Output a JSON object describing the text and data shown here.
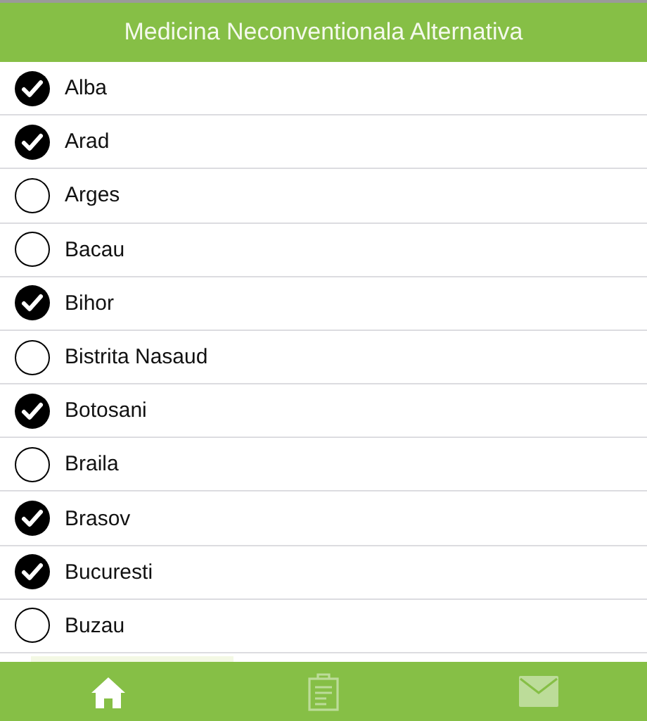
{
  "header": {
    "title": "Medicina Neconventionala Alternativa"
  },
  "items": [
    {
      "label": "Alba",
      "checked": true
    },
    {
      "label": "Arad",
      "checked": true
    },
    {
      "label": "Arges",
      "checked": false
    },
    {
      "label": "Bacau",
      "checked": false
    },
    {
      "label": "Bihor",
      "checked": true
    },
    {
      "label": "Bistrita Nasaud",
      "checked": false
    },
    {
      "label": "Botosani",
      "checked": true
    },
    {
      "label": "Braila",
      "checked": false
    },
    {
      "label": "Brasov",
      "checked": true
    },
    {
      "label": "Bucuresti",
      "checked": true
    },
    {
      "label": "Buzau",
      "checked": false
    }
  ],
  "tabs": [
    {
      "kind": "home",
      "selected": true
    },
    {
      "kind": "clipboard",
      "selected": false
    },
    {
      "kind": "mail",
      "selected": false
    }
  ]
}
